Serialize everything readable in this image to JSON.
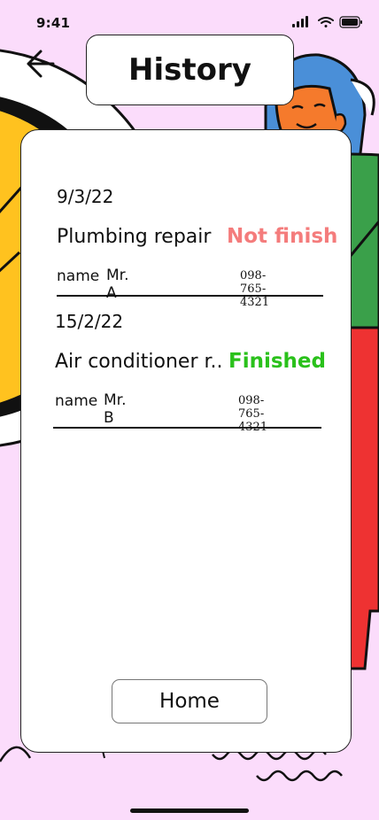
{
  "status_bar": {
    "time": "9:41"
  },
  "header": {
    "title": "History"
  },
  "history": [
    {
      "date": "9/3/22",
      "service": "Plumbing repair",
      "status": "Not finish",
      "status_color": "#f47c7c",
      "name_label": "name",
      "name": "Mr. A",
      "phone": "098-765-4321"
    },
    {
      "date": "15/2/22",
      "service": "Air conditioner r..",
      "status": "Finished",
      "status_color": "#2ac11b",
      "name_label": "name",
      "name": "Mr. B",
      "phone": "098-765-4321"
    }
  ],
  "footer": {
    "home_label": "Home"
  },
  "colors": {
    "background": "#fbdcfb",
    "accent_yellow": "#ffc21f",
    "accent_blue": "#4a8fd8",
    "accent_green": "#3aa04a",
    "accent_red": "#ee3232"
  },
  "icons": {
    "back": "arrow-left-icon",
    "signal": "signal-icon",
    "wifi": "wifi-icon",
    "battery": "battery-icon"
  }
}
